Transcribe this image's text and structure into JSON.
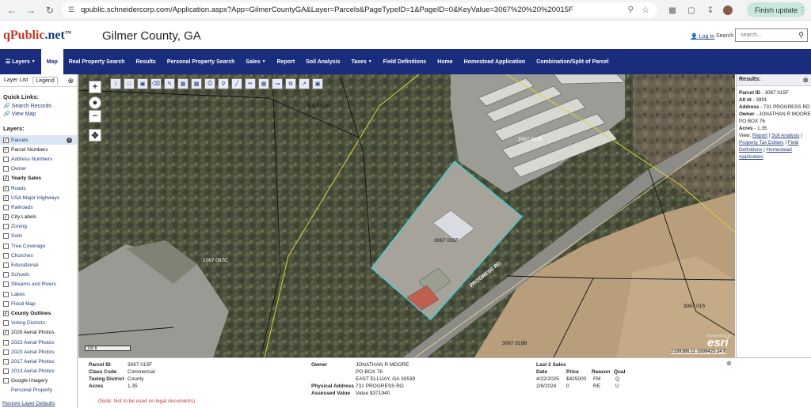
{
  "browser": {
    "url": "qpublic.schneidercorp.com/Application.aspx?App=GilmerCountyGA&Layer=Parcels&PageTypeID=1&PageID=0&KeyValue=3067%20%20%20015F",
    "finish_update": "Finish update"
  },
  "header": {
    "logo_q": "qPublic",
    "logo_net": ".net",
    "logo_tm": "TM",
    "county": "Gilmer County, GA",
    "login": "Log In",
    "search_label": "Search",
    "search_placeholder": "search..."
  },
  "nav": {
    "items": [
      "Layers",
      "Map",
      "Real Property Search",
      "Results",
      "Personal Property Search",
      "Sales",
      "Report",
      "Soil Analysis",
      "Taxes",
      "Field Definitions",
      "Home",
      "Homestead Application",
      "Combination/Split of Parcel"
    ]
  },
  "left": {
    "tab_layer_list": "Layer List",
    "tab_legend": "Legend",
    "quick_links_title": "Quick Links:",
    "search_records": "Search Records",
    "view_map": "View Map",
    "layers_title": "Layers:",
    "layers": [
      {
        "label": "Parcels",
        "checked": true
      },
      {
        "label": "Parcel Numbers",
        "checked": true
      },
      {
        "label": "Address Numbers",
        "checked": false
      },
      {
        "label": "Owner",
        "checked": false
      },
      {
        "label": "Yearly Sales",
        "checked": true
      },
      {
        "label": "Roads",
        "checked": true
      },
      {
        "label": "USA Major Highways",
        "checked": true
      },
      {
        "label": "Railroads",
        "checked": false
      },
      {
        "label": "City Labels",
        "checked": true
      },
      {
        "label": "Zoning",
        "checked": false
      },
      {
        "label": "Soils",
        "checked": false
      },
      {
        "label": "Tree Coverage",
        "checked": false
      },
      {
        "label": "Churches",
        "checked": false
      },
      {
        "label": "Educational",
        "checked": false
      },
      {
        "label": "Schools",
        "checked": false
      },
      {
        "label": "Streams and Rivers",
        "checked": false
      },
      {
        "label": "Lakes",
        "checked": false
      },
      {
        "label": "Flood Map",
        "checked": false
      },
      {
        "label": "County Outlines",
        "checked": true
      },
      {
        "label": "Voting Districts",
        "checked": false
      },
      {
        "label": "2026 Aerial Photos",
        "checked": true
      },
      {
        "label": "2023 Aerial Photos",
        "checked": false
      },
      {
        "label": "2020 Aerial Photos",
        "checked": false
      },
      {
        "label": "2017 Aerial Photos",
        "checked": false
      },
      {
        "label": "2013 Aerial Photos",
        "checked": false
      },
      {
        "label": "Google Imagery",
        "checked": false
      },
      {
        "label": "Personal Property",
        "checked": null
      }
    ],
    "restore": "Restore Layer Defaults"
  },
  "map": {
    "labels": {
      "p016": "3067 016",
      "p015e": "3067 015E",
      "p015f": "3067 015F",
      "p087c": "1067 087C",
      "p015": "3067 015",
      "p019b": "3067 019B",
      "road": "PROGRESS RD"
    },
    "scale": "100 ft",
    "coords": "2199386.11 1699423.24 ft",
    "esri_powered": "POWERED BY",
    "esri": "esri"
  },
  "results": {
    "title": "Results:",
    "parcel_id_label": "Parcel ID",
    "parcel_id": "3067 015F",
    "alt_id_label": "Alt Id",
    "alt_id": "3991",
    "address_label": "Address",
    "address": "731 PROGRESS RD",
    "owner_label": "Owner",
    "owner": "JONATHAN R MOORE",
    "owner_addr": "PO BOX 76",
    "acres_label": "Acres",
    "acres": "1.35",
    "view_label": "View:",
    "report": "Report",
    "soil": "Soil Analysis",
    "tax": "Property Tax Dollars",
    "field_defs": "Field Definitions",
    "homestead": "Homestead Application"
  },
  "bottom": {
    "parcel_id_label": "Parcel ID",
    "parcel_id": "3067 015F",
    "class_code_label": "Class Code",
    "class_code": "Commercial",
    "taxing_district_label": "Taxing District",
    "taxing_district": "County",
    "acres_label": "Acres",
    "acres": "1.35",
    "owner_label": "Owner",
    "owner_line1": "JONATHAN R MOORE",
    "owner_line2": "PO BOX 76",
    "owner_line3": "EAST ELLIJAY, GA 30539",
    "physical_address_label": "Physical Address",
    "physical_address": "731 PROGRESS RD",
    "assessed_value_label": "Assessed Value",
    "assessed_value": "Value $371940",
    "last_sales_title": "Last 2 Sales",
    "sales_headers": [
      "Date",
      "Price",
      "Reason",
      "Qual"
    ],
    "sales": [
      [
        "4/22/2025",
        "$425000",
        "FM",
        "Q"
      ],
      [
        "2/8/2024",
        "0",
        "RE",
        "U"
      ]
    ],
    "note": "(Note: Not to be used on legal documents)"
  }
}
